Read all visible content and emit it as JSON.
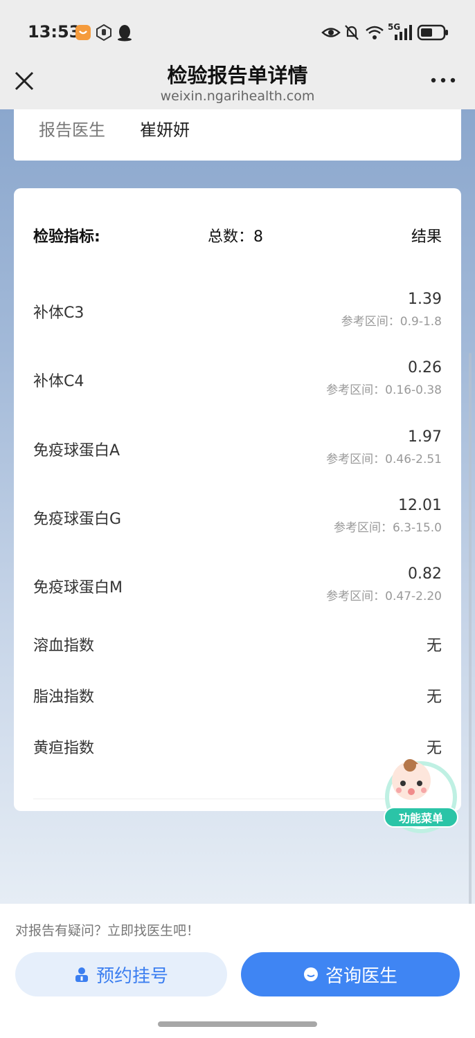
{
  "status_bar": {
    "time": "13:53",
    "network": "5G",
    "icons": [
      "notification-app-icon",
      "hand-icon",
      "qq-icon",
      "eye-icon",
      "mute-bell-icon",
      "wifi-icon",
      "signal-icon",
      "battery-icon"
    ]
  },
  "nav": {
    "title": "检验报告单详情",
    "subtitle": "weixin.ngarihealth.com",
    "close_icon": "close-icon",
    "more_icon": "more-icon"
  },
  "report_doctor": {
    "label": "报告医生",
    "name": "崔妍妍"
  },
  "results": {
    "header_label": "检验指标:",
    "header_count": "总数：8",
    "header_result": "结果",
    "items": [
      {
        "name": "补体C3",
        "value": "1.39",
        "ref": "参考区间：0.9-1.8"
      },
      {
        "name": "补体C4",
        "value": "0.26",
        "ref": "参考区间：0.16-0.38"
      },
      {
        "name": "免疫球蛋白A",
        "value": "1.97",
        "ref": "参考区间：0.46-2.51"
      },
      {
        "name": "免疫球蛋白G",
        "value": "12.01",
        "ref": "参考区间：6.3-15.0"
      },
      {
        "name": "免疫球蛋白M",
        "value": "0.82",
        "ref": "参考区间：0.47-2.20"
      },
      {
        "name": "溶血指数",
        "value": "无"
      },
      {
        "name": "脂浊指数",
        "value": "无"
      },
      {
        "name": "黄疸指数",
        "value": "无"
      }
    ]
  },
  "mascot": {
    "label": "功能菜单"
  },
  "footer": {
    "tip": "对报告有疑问？立即找医生吧！",
    "book_label": "预约挂号",
    "consult_label": "咨询医生"
  },
  "colors": {
    "accent": "#3f85f3",
    "accent_light": "#e6effb",
    "mascot_green": "#2bc4a7"
  }
}
